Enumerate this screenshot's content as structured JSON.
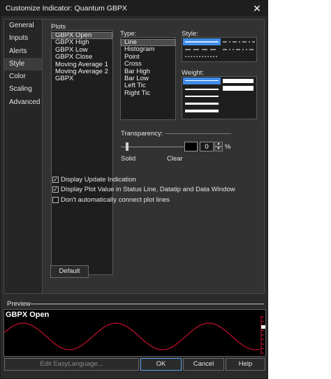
{
  "window": {
    "title": "Customize Indicator: Quantum GBPX"
  },
  "nav": {
    "items": [
      "General",
      "Inputs",
      "Alerts",
      "Style",
      "Color",
      "Scaling",
      "Advanced"
    ],
    "active": "Style"
  },
  "plots": {
    "label": "Plots",
    "items": [
      "GBPX Open",
      "GBPX High",
      "GBPX Low",
      "GBPX Close",
      "Moving Average 1",
      "Moving Average 2",
      "GBPX"
    ],
    "selected": "GBPX Open"
  },
  "type": {
    "label": "Type:",
    "items": [
      "Line",
      "Histogram",
      "Point",
      "Cross",
      "Bar High",
      "Bar Low",
      "Left Tic",
      "Right Tic"
    ],
    "selected": "Line"
  },
  "style": {
    "label": "Style:"
  },
  "weight": {
    "label": "Weight:"
  },
  "transparency": {
    "label": "Transparency:",
    "min_label": "Solid",
    "max_label": "Clear",
    "value": "0",
    "unit": "%",
    "fraction": 0.0,
    "swatch_color": "#000000"
  },
  "options": {
    "display_update": "Display Update Indication",
    "display_plot_value": "Display Plot Value in Status Line, Datatip and Data Window",
    "dont_connect": "Don't automatically connect plot lines"
  },
  "buttons": {
    "default": "Default",
    "edit": "Edit EasyLanguage...",
    "ok": "OK",
    "cancel": "Cancel",
    "help": "Help"
  },
  "preview": {
    "label": "Preview",
    "title": "GBPX Open",
    "line_color": "#c8102e"
  },
  "colors": {
    "selection": "#3f8ce8",
    "accent_border": "#5aa0f0"
  }
}
